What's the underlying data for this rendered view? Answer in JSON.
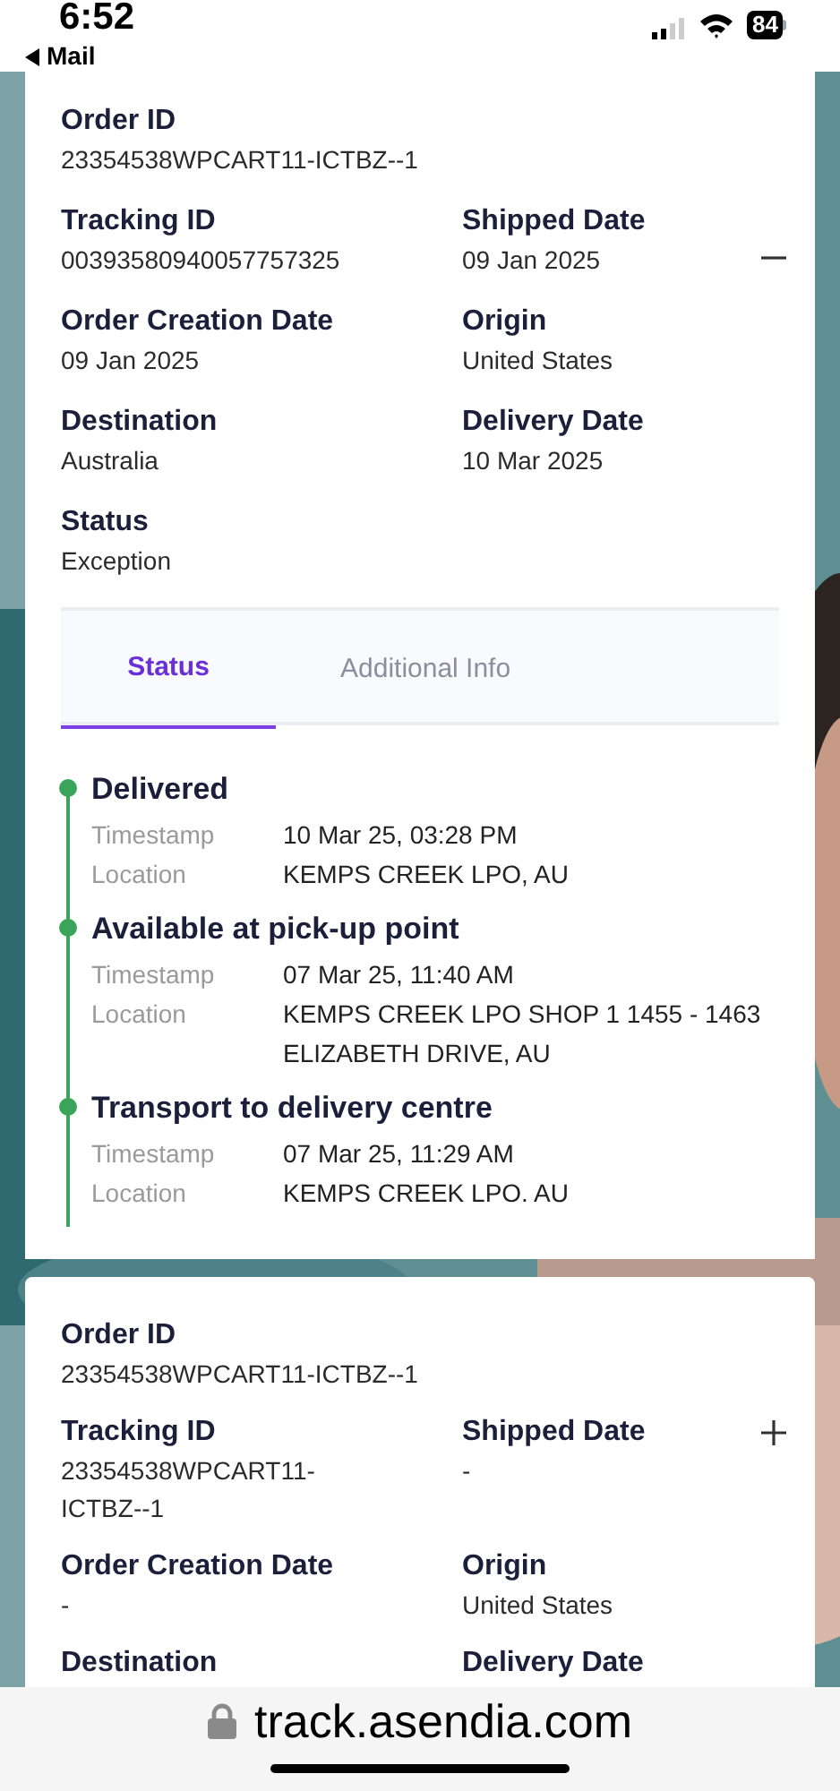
{
  "status_bar": {
    "time": "6:52",
    "back_label": "Mail",
    "battery": "84"
  },
  "orders": [
    {
      "expanded": true,
      "order_id": {
        "label": "Order ID",
        "value": "23354538WPCART11-ICTBZ--1"
      },
      "details": [
        {
          "label": "Tracking ID",
          "value": "00393580940057757325"
        },
        {
          "label": "Shipped Date",
          "value": "09 Jan 2025"
        },
        {
          "label": "Order Creation Date",
          "value": "09 Jan 2025"
        },
        {
          "label": "Origin",
          "value": "United States"
        },
        {
          "label": "Destination",
          "value": "Australia"
        },
        {
          "label": "Delivery Date",
          "value": "10 Mar 2025"
        },
        {
          "label": "Status",
          "value": "Exception"
        }
      ],
      "tabs": [
        {
          "label": "Status",
          "selected": true
        },
        {
          "label": "Additional Info",
          "selected": false
        }
      ],
      "events": [
        {
          "title": "Delivered",
          "rows": [
            {
              "label": "Timestamp",
              "value": "10 Mar 25, 03:28 PM"
            },
            {
              "label": "Location",
              "value": "KEMPS CREEK LPO, AU"
            }
          ]
        },
        {
          "title": "Available at pick-up point",
          "rows": [
            {
              "label": "Timestamp",
              "value": "07 Mar 25, 11:40 AM"
            },
            {
              "label": "Location",
              "value": "KEMPS CREEK LPO SHOP 1 1455 - 1463 ELIZABETH DRIVE, AU"
            }
          ]
        },
        {
          "title": "Transport to delivery centre",
          "rows": [
            {
              "label": "Timestamp",
              "value": "07 Mar 25, 11:29 AM"
            },
            {
              "label": "Location",
              "value": "KEMPS CREEK LPO. AU"
            }
          ]
        }
      ]
    },
    {
      "expanded": false,
      "order_id": {
        "label": "Order ID",
        "value": "23354538WPCART11-ICTBZ--1"
      },
      "details": [
        {
          "label": "Tracking ID",
          "value": "23354538WPCART11-ICTBZ--1"
        },
        {
          "label": "Shipped Date",
          "value": "-"
        },
        {
          "label": "Order Creation Date",
          "value": "-"
        },
        {
          "label": "Origin",
          "value": "United States"
        },
        {
          "label": "Destination"
        },
        {
          "label": "Delivery Date"
        }
      ]
    }
  ],
  "address_bar": {
    "url": "track.asendia.com"
  }
}
